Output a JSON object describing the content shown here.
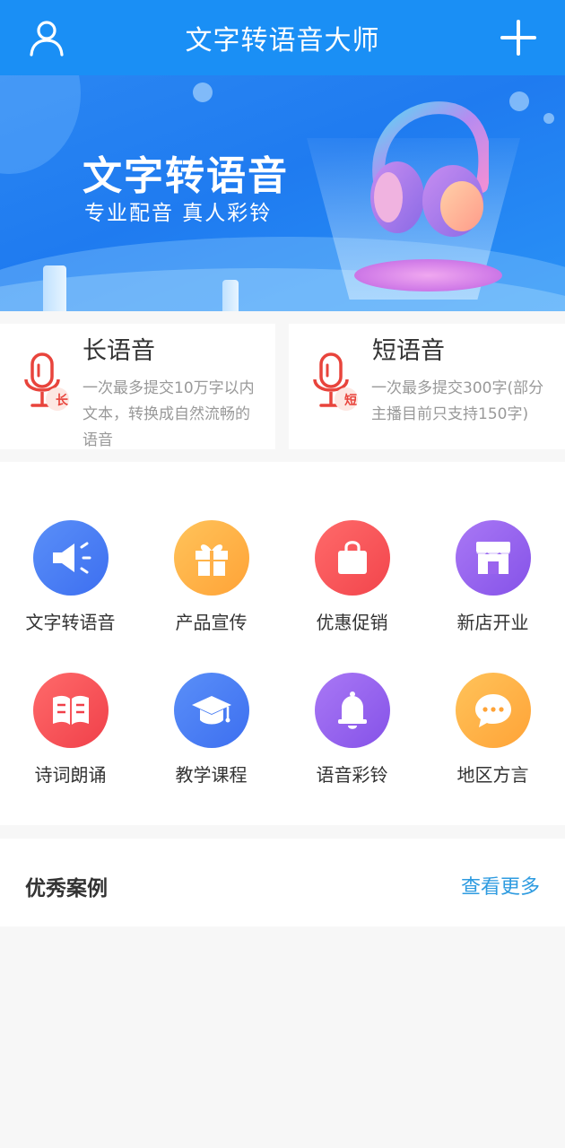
{
  "header": {
    "title": "文字转语音大师",
    "user_icon": "user-icon",
    "add_icon": "plus-icon"
  },
  "banner": {
    "headline": "文字转语音",
    "subline": "专业配音 真人彩铃",
    "image_icon": "headphones-icon"
  },
  "cards": [
    {
      "title": "长语音",
      "badge": "长",
      "description": "一次最多提交10万字以内文本，转换成自然流畅的语音",
      "icon": "microphone-icon"
    },
    {
      "title": "短语音",
      "badge": "短",
      "description": "一次最多提交300字(部分主播目前只支持150字)",
      "icon": "microphone-icon"
    }
  ],
  "grid": [
    {
      "label": "文字转语音",
      "icon": "speaker-icon",
      "color_from": "#5a8ff8",
      "color_to": "#3d6ff0"
    },
    {
      "label": "产品宣传",
      "icon": "gift-icon",
      "color_from": "#ffc35a",
      "color_to": "#ffa337"
    },
    {
      "label": "优惠促销",
      "icon": "shopping-bag-icon",
      "color_from": "#ff6a6a",
      "color_to": "#f2454c"
    },
    {
      "label": "新店开业",
      "icon": "store-icon",
      "color_from": "#a978f5",
      "color_to": "#8552e8"
    },
    {
      "label": "诗词朗诵",
      "icon": "book-icon",
      "color_from": "#ff6a6a",
      "color_to": "#f0404a"
    },
    {
      "label": "教学课程",
      "icon": "graduation-cap-icon",
      "color_from": "#5a8ff8",
      "color_to": "#3d6ff0"
    },
    {
      "label": "语音彩铃",
      "icon": "bell-icon",
      "color_from": "#a978f5",
      "color_to": "#8552e8"
    },
    {
      "label": "地区方言",
      "icon": "chat-bubble-icon",
      "color_from": "#ffc35a",
      "color_to": "#ffa337"
    }
  ],
  "cases": {
    "title": "优秀案例",
    "more_label": "查看更多"
  }
}
